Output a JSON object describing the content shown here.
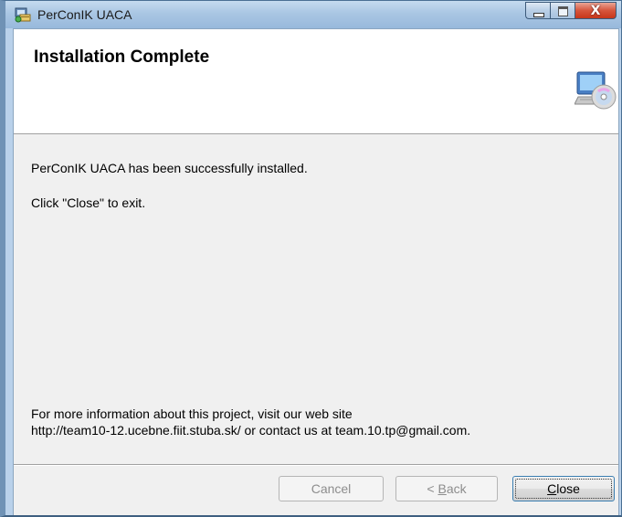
{
  "window": {
    "title": "PerConIK UACA"
  },
  "caption_buttons": {
    "close_glyph": "X"
  },
  "header": {
    "title": "Installation Complete",
    "icon": "computer-cd-icon"
  },
  "body": {
    "line1": "PerConIK UACA has been successfully installed.",
    "line2": "Click \"Close\" to exit.",
    "info_line1": "For more information about this project, visit our web site",
    "info_line2": "http://team10-12.ucebne.fiit.stuba.sk/ or contact us at team.10.tp@gmail.com."
  },
  "buttons": {
    "cancel": "Cancel",
    "back_prefix": "< ",
    "back_mnemonic": "B",
    "back_rest": "ack",
    "close_mnemonic": "C",
    "close_rest": "lose"
  },
  "colors": {
    "titlebar": "#a9c6e3",
    "close_button": "#d6553c",
    "client_bg": "#f0f0f0",
    "focus_border": "#3c7fb1"
  }
}
